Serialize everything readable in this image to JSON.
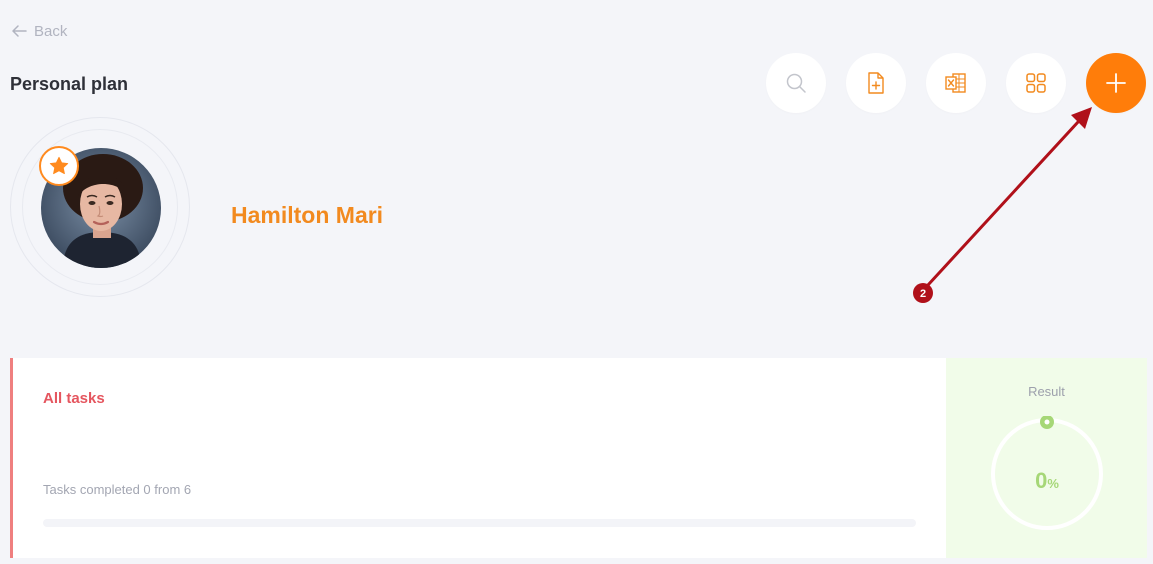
{
  "nav": {
    "back_label": "Back"
  },
  "page": {
    "title": "Personal plan"
  },
  "toolbar": {
    "buttons": [
      {
        "icon": "search-icon"
      },
      {
        "icon": "add-document-icon"
      },
      {
        "icon": "excel-export-icon"
      },
      {
        "icon": "grid-view-icon"
      },
      {
        "icon": "plus-icon"
      }
    ]
  },
  "profile": {
    "name": "Hamilton Mari",
    "badge_icon": "star-icon"
  },
  "annotation": {
    "step": "2"
  },
  "tasks": {
    "label": "All tasks",
    "progress_text": "Tasks completed 0 from 6",
    "progress": 0
  },
  "result": {
    "label": "Result",
    "value": "0",
    "unit": "%"
  },
  "colors": {
    "accent": "#ff7d0a",
    "name": "#f28a1f",
    "tasks_label": "#e5565f",
    "result_green": "#a6d777",
    "annotation": "#b0101a"
  }
}
